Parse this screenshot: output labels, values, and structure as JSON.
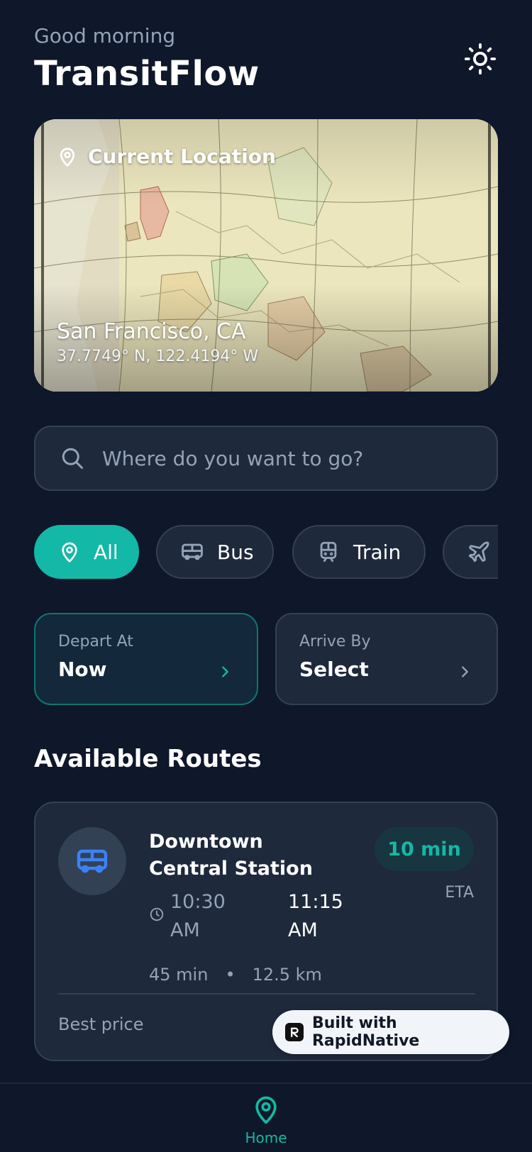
{
  "header": {
    "greeting": "Good morning",
    "title": "TransitFlow",
    "theme_icon": "sun-icon"
  },
  "location_card": {
    "label": "Current Location",
    "city": "San Francisco, CA",
    "coordinates": "37.7749° N, 122.4194° W"
  },
  "search": {
    "placeholder": "Where do you want to go?"
  },
  "filters": [
    {
      "label": "All",
      "icon": "map-pin-icon",
      "active": true
    },
    {
      "label": "Bus",
      "icon": "bus-icon",
      "active": false
    },
    {
      "label": "Train",
      "icon": "train-icon",
      "active": false
    },
    {
      "label": "",
      "icon": "plane-icon",
      "active": false
    }
  ],
  "time_options": {
    "depart": {
      "label": "Depart At",
      "value": "Now"
    },
    "arrive": {
      "label": "Arrive By",
      "value": "Select"
    }
  },
  "routes": {
    "heading": "Available Routes",
    "items": [
      {
        "name": "Downtown Central Station",
        "eta_badge": "10 min",
        "eta_label": "ETA",
        "depart_time": "10:30 AM",
        "arrive_time": "11:15 AM",
        "duration": "45 min",
        "separator": "•",
        "distance": "12.5 km",
        "price_label": "Best price"
      }
    ]
  },
  "badge": {
    "text": "Built with RapidNative"
  },
  "nav": {
    "home_label": "Home"
  },
  "colors": {
    "background": "#0f172a",
    "surface": "#1e293b",
    "border": "#334155",
    "accent": "#14b8a6",
    "muted_text": "#94a3b8",
    "bus_icon": "#3b82f6"
  }
}
